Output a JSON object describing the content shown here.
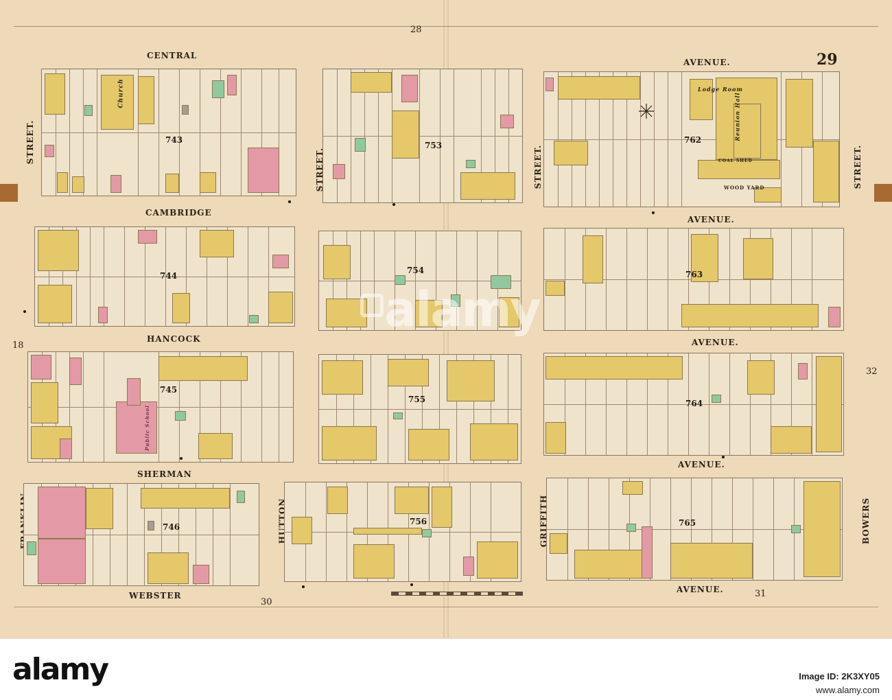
{
  "plate_number": "29",
  "adjoining_plates": {
    "top": "28",
    "left": "18",
    "right": "32",
    "bottom_left": "30",
    "bottom_right": "31"
  },
  "streets_horizontal": [
    {
      "name": "CENTRAL"
    },
    {
      "name": "AVENUE."
    },
    {
      "name": "CAMBRIDGE"
    },
    {
      "name": "AVENUE."
    },
    {
      "name": "HANCOCK"
    },
    {
      "name": "AVENUE."
    },
    {
      "name": "SHERMAN"
    },
    {
      "name": "AVENUE."
    },
    {
      "name": "WEBSTER"
    },
    {
      "name": "AVENUE."
    }
  ],
  "streets_vertical": [
    {
      "name": "STREET."
    },
    {
      "name": "STREET."
    },
    {
      "name": "STREET."
    },
    {
      "name": "STREET."
    },
    {
      "name": "FRANKLIN"
    },
    {
      "name": "HUTTON"
    },
    {
      "name": "GRIFFITH"
    },
    {
      "name": "BOWERS"
    }
  ],
  "blocks": [
    "743",
    "753",
    "762",
    "744",
    "754",
    "763",
    "745",
    "755",
    "764",
    "746",
    "756",
    "765"
  ],
  "building_labels": [
    "Church",
    "Lodge Room",
    "Reunion Hall",
    "WOOD YARD",
    "COAL SHED",
    "Public School"
  ],
  "watermark": "alamy",
  "footer": {
    "logo": "alamy",
    "image_id_label": "Image ID: 2K3XY05",
    "site": "www.alamy.com"
  },
  "colors": {
    "paper": "#eed9b8",
    "yellow_frame": "#e4c86a",
    "pink_brick": "#e39aa6",
    "green_stone": "#8fc9a0"
  }
}
